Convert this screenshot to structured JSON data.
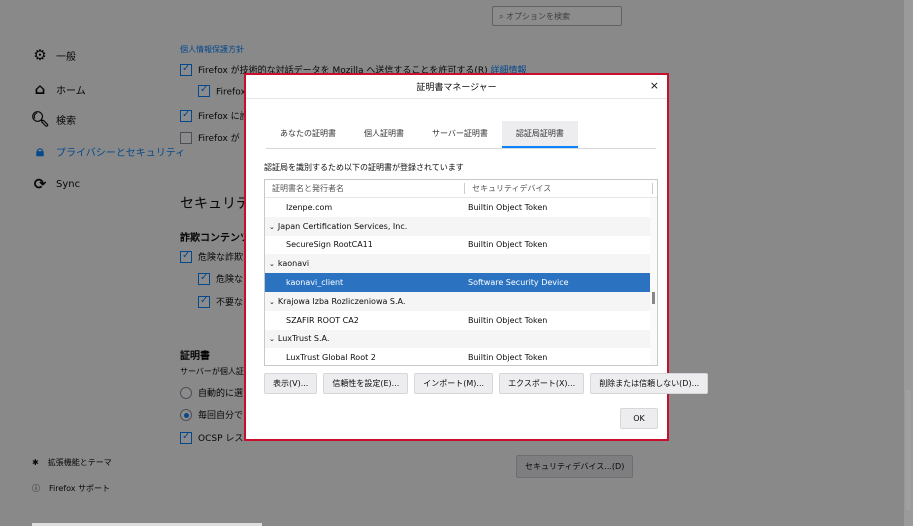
{
  "search": {
    "placeholder": "オプションを検索"
  },
  "sidebar": {
    "items": [
      {
        "label": "一般",
        "icon": "gear-icon"
      },
      {
        "label": "ホーム",
        "icon": "home-icon"
      },
      {
        "label": "検索",
        "icon": "search-icon"
      },
      {
        "label": "プライバシーとセキュリティ",
        "icon": "lock-icon"
      },
      {
        "label": "Sync",
        "icon": "sync-icon"
      }
    ],
    "footer": [
      {
        "label": "拡張機能とテーマ",
        "icon": "puzzle-icon"
      },
      {
        "label": "Firefox サポート",
        "icon": "help-icon"
      }
    ]
  },
  "background": {
    "section_top": "個人情報保護方針",
    "cb1": "Firefox が技術的な対話データを Mozilla へ送信することを許可する(R)",
    "cb1_link": "詳細情報",
    "cb2": "Firefox",
    "cb3": "Firefox に許",
    "cb4": "Firefox が",
    "security_heading": "セキュリティ",
    "deceptive_heading": "詐欺コンテンツ",
    "cb5": "危険な詐欺",
    "cb6": "危険な",
    "cb7": "不要な",
    "cert_heading": "証明書",
    "cert_desc": "サーバーが個人証",
    "radio1": "自動的に選",
    "radio2": "毎回自分で",
    "cb8": "OCSP レス",
    "security_devices_button": "セキュリティデバイス...(D)"
  },
  "dialog": {
    "title": "証明書マネージャー",
    "tabs": [
      "あなたの証明書",
      "個人証明書",
      "サーバー証明書",
      "認証局証明書"
    ],
    "active_tab": 3,
    "description": "認証局を識別するため以下の証明書が登録されています",
    "columns": [
      "証明書名と発行者名",
      "セキュリティデバイス"
    ],
    "rows": [
      {
        "name": "Izenpe.com",
        "device": "Builtin Object Token",
        "kind": "child"
      },
      {
        "name": "Japan Certification Services, Inc.",
        "device": "",
        "kind": "parent"
      },
      {
        "name": "SecureSign RootCA11",
        "device": "Builtin Object Token",
        "kind": "child"
      },
      {
        "name": "kaonavi",
        "device": "",
        "kind": "parent"
      },
      {
        "name": "kaonavi_client",
        "device": "Software Security Device",
        "kind": "child",
        "selected": true
      },
      {
        "name": "Krajowa Izba Rozliczeniowa S.A.",
        "device": "",
        "kind": "parent"
      },
      {
        "name": "SZAFIR ROOT CA2",
        "device": "Builtin Object Token",
        "kind": "child"
      },
      {
        "name": "LuxTrust S.A.",
        "device": "",
        "kind": "parent"
      },
      {
        "name": "LuxTrust Global Root 2",
        "device": "Builtin Object Token",
        "kind": "child"
      }
    ],
    "buttons": {
      "view": "表示(V)...",
      "trust": "信頼性を設定(E)...",
      "import": "インポート(M)...",
      "export": "エクスポート(X)...",
      "delete": "削除または信頼しない(D)..."
    },
    "ok": "OK",
    "close_glyph": "×"
  }
}
